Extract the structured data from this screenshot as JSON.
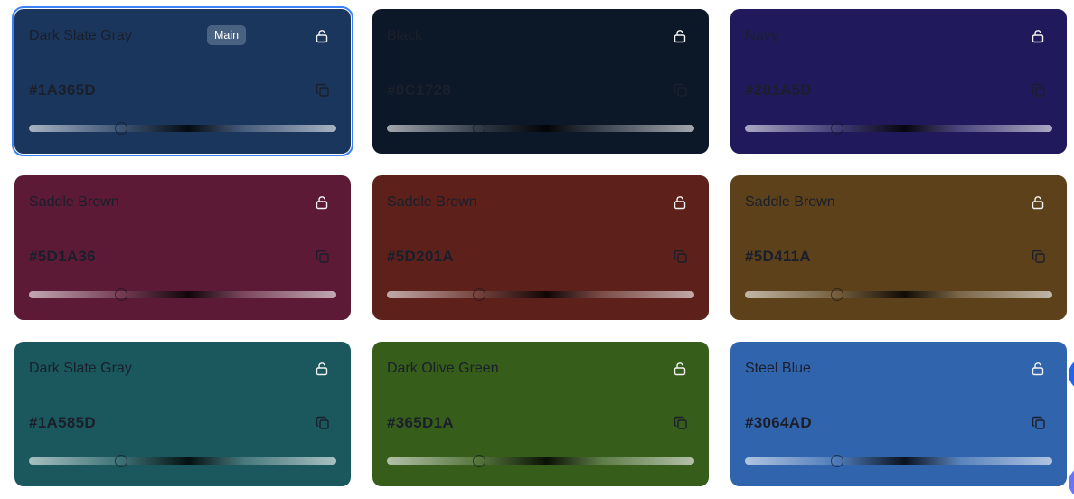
{
  "cards": [
    {
      "name": "Dark Slate Gray",
      "hex": "#1A365D",
      "bg": "#1a365d",
      "selected": true,
      "badge": "Main",
      "slider_value": 0.3
    },
    {
      "name": "Black",
      "hex": "#0C1728",
      "bg": "#0c1728",
      "selected": false,
      "badge": "",
      "slider_value": 0.3
    },
    {
      "name": "Navy",
      "hex": "#201A5D",
      "bg": "#201a5d",
      "selected": false,
      "badge": "",
      "slider_value": 0.3
    },
    {
      "name": "Saddle Brown",
      "hex": "#5D1A36",
      "bg": "#5d1a36",
      "selected": false,
      "badge": "",
      "slider_value": 0.3
    },
    {
      "name": "Saddle Brown",
      "hex": "#5D201A",
      "bg": "#5d201a",
      "selected": false,
      "badge": "",
      "slider_value": 0.3
    },
    {
      "name": "Saddle Brown",
      "hex": "#5D411A",
      "bg": "#5d411a",
      "selected": false,
      "badge": "",
      "slider_value": 0.3
    },
    {
      "name": "Dark Slate Gray",
      "hex": "#1A585D",
      "bg": "#1a585d",
      "selected": false,
      "badge": "",
      "slider_value": 0.3
    },
    {
      "name": "Dark Olive Green",
      "hex": "#365D1A",
      "bg": "#365d1a",
      "selected": false,
      "badge": "",
      "slider_value": 0.3
    },
    {
      "name": "Steel Blue",
      "hex": "#3064AD",
      "bg": "#3064ad",
      "selected": false,
      "badge": "",
      "slider_value": 0.3
    }
  ],
  "icons": {
    "lock": "unlock-icon",
    "copy": "copy-icon"
  },
  "colors": {
    "selection_outline": "#3b82f6",
    "text_dark": "#1a1f2b",
    "fab": "#4a6cf0"
  }
}
